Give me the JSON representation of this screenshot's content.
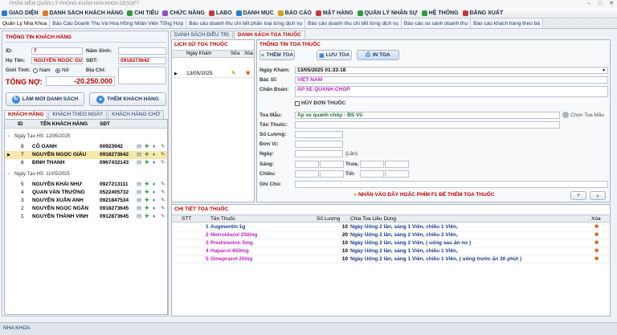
{
  "window": {
    "title": "PHẦN MỀM QUẢN LÝ PHÒNG KHÁM NHA KHOA DESOFT"
  },
  "menu": [
    {
      "label": "GIAO DIỆN",
      "icon": "home-icon",
      "color": "#2b7bd6"
    },
    {
      "label": "DANH SÁCH KHÁCH HÀNG",
      "icon": "users-icon",
      "color": "#e07b1a"
    },
    {
      "label": "CHI TIÊU",
      "icon": "money-icon",
      "color": "#2e9b3a"
    },
    {
      "label": "CHỨC NĂNG",
      "icon": "function-icon",
      "color": "#8a4fd1"
    },
    {
      "label": "LABO",
      "icon": "labo-icon",
      "color": "#c23b3b"
    },
    {
      "label": "DANH MỤC",
      "icon": "list-icon",
      "color": "#2b7bd6"
    },
    {
      "label": "BÁO CÁO",
      "icon": "report-icon",
      "color": "#d6a21e"
    },
    {
      "label": "MẶT HÀNG",
      "icon": "goods-icon",
      "color": "#c23b3b"
    },
    {
      "label": "QUẢN LÝ NHÂN SỰ",
      "icon": "staff-icon",
      "color": "#2e9b3a"
    },
    {
      "label": "HỆ THỐNG",
      "icon": "system-icon",
      "color": "#2e9b3a"
    },
    {
      "label": "ĐĂNG XUẤT",
      "icon": "logout-icon",
      "color": "#c23b3b"
    }
  ],
  "tabs": [
    "Quản Lý Nha Khoa",
    "Báo Cáo Doanh Thu Và Hoa Hồng Nhân Viên Tổng Hợp",
    "Báo cáo doanh thu chi tiết phân loại từng dịch vụ",
    "Báo cáo doanh thu chi tiết từng dịch vụ",
    "Báo cáo so sánh doanh thu",
    "Báo cáo khách hàng theo bá"
  ],
  "customer": {
    "section": "THÔNG TIN KHÁCH HÀNG",
    "id_label": "ID:",
    "id": "7",
    "dob_label": "Năm Sinh:",
    "dob": "",
    "name_label": "Họ Tên:",
    "name": "NGUYỄN NGỌC GIÀU",
    "phone_label": "SĐT:",
    "phone": "0918273642",
    "gender_label": "Giới Tính:",
    "male": "Nam",
    "female": "Nữ",
    "address_label": "Địa Chỉ:",
    "debt_label": "TỔNG NỢ:",
    "debt": "-20.250.000",
    "refresh_btn": "LÀM MỚI DANH SÁCH",
    "add_btn": "THÊM KHÁCH HÀNG"
  },
  "cust_tabs": [
    "KHÁCH HÀNG",
    "KHÁCH THEO NGÀY",
    "KHÁCH HÀNG CHỜ"
  ],
  "cust_cols": [
    "ID",
    "TÊN KHÁCH HÀNG",
    "SĐT"
  ],
  "groups": [
    {
      "label": "Ngày Tạo HS: 12/05/2025",
      "rows": [
        {
          "id": "8",
          "name": "CÔ OANH",
          "phone": "00923942"
        },
        {
          "id": "7",
          "name": "NGUYỄN NGỌC GIÀU",
          "phone": "0918273642",
          "selected": true
        },
        {
          "id": "6",
          "name": "ĐINH THANH",
          "phone": "0967432143"
        }
      ]
    },
    {
      "label": "Ngày Tạo HS: 11/05/2025",
      "rows": [
        {
          "id": "5",
          "name": "NGUYỄN KHẢI NHƯ",
          "phone": "0927213111"
        },
        {
          "id": "4",
          "name": "QUAN VĂN TRƯỜNG",
          "phone": "0522405732"
        },
        {
          "id": "3",
          "name": "NGUYỄN XUÂN ANH",
          "phone": "0921847534"
        },
        {
          "id": "2",
          "name": "NGUYỄN NGỌC NGÂN",
          "phone": "0918273645"
        },
        {
          "id": "1",
          "name": "NGUYỄN THÀNH VINH",
          "phone": "0912873645"
        }
      ]
    }
  ],
  "main_tabs": [
    "DANH SÁCH ĐIỀU TRỊ",
    "DANH SÁCH TOA THUỐC"
  ],
  "history": {
    "title": "LỊCH SỬ TOA THUỐC",
    "cols": [
      "Ngày Khám",
      "Sửa",
      "Xóa"
    ],
    "rows": [
      {
        "date": "13/05/2025"
      }
    ]
  },
  "rx": {
    "title": "THÔNG TIN TOA THUỐC",
    "add_btn": "THÊM TOA",
    "save_btn": "LƯU TOA",
    "print_btn": "IN TOA",
    "date_label": "Ngày Khám:",
    "date": "13/05/2025 01:33:18",
    "doctor_label": "Bác Sĩ:",
    "doctor": "VIỆT NAM",
    "diag_label": "Chẩn Đoán:",
    "diag": "ÁP XE QUANH CHÓP",
    "cancel_label": "HỦY ĐƠN THUỐC",
    "template_label": "Toa Mẫu:",
    "template": "Áp xe quanh chóp - BS Vũ",
    "template_btn": "Chọn Toa Mẫu",
    "drug_label": "Tên Thuốc:",
    "qty_label": "Số Lượng:",
    "unit_label": "Đơn Vị:",
    "day_label": "Ngày:",
    "times_label": "(Lần)",
    "morning_label": "Sáng:",
    "noon_label": "Trưa:",
    "afternoon_label": "Chiều:",
    "night_label": "Tối:",
    "note_label": "Ghi Chú:",
    "hint": "NHẤN VÀO ĐÂY HOẶC PHÍM F1 ĐỂ THÊM TOA THUỐC"
  },
  "detail": {
    "title": "CHI TIẾT TOA THUỐC",
    "cols": [
      "STT",
      "Tên Thuốc",
      "Số Lượng",
      "Chia Toa Liều Dùng",
      "Xóa"
    ],
    "rows": [
      {
        "stt": "1",
        "drug": "Augmentin 1g",
        "qty": "10",
        "dose": "Ngày Uống 2 lần, sáng 1 Viên, chiều 1 Viên,",
        "color": "#1b3a8c"
      },
      {
        "stt": "2",
        "drug": "Metroidazol 250mg",
        "qty": "20",
        "dose": "Ngày Uống 2 lần, sáng 2 Viên, chiều 2 Viên,",
        "color": "#c020c0"
      },
      {
        "stt": "3",
        "drug": "Prednisolon 5mg",
        "qty": "10",
        "dose": "Ngày Uống 2 lần, sáng 2 Viên, ( uống sau ăn no )",
        "color": "#c020c0"
      },
      {
        "stt": "4",
        "drug": "Hapacol 650mg",
        "qty": "10",
        "dose": "Ngày Uống 2 lần, sáng 1 Viên, chiều 1 Viên,",
        "color": "#c020c0"
      },
      {
        "stt": "5",
        "drug": "Omeprazol 20mg",
        "qty": "10",
        "dose": "Ngày Uống 2 lần, sáng 1 Viên, chiều 1 Viên, ( uống trước ăn 30 phút )",
        "color": "#c020c0"
      }
    ]
  },
  "status": {
    "text": "NHA KHOA"
  }
}
